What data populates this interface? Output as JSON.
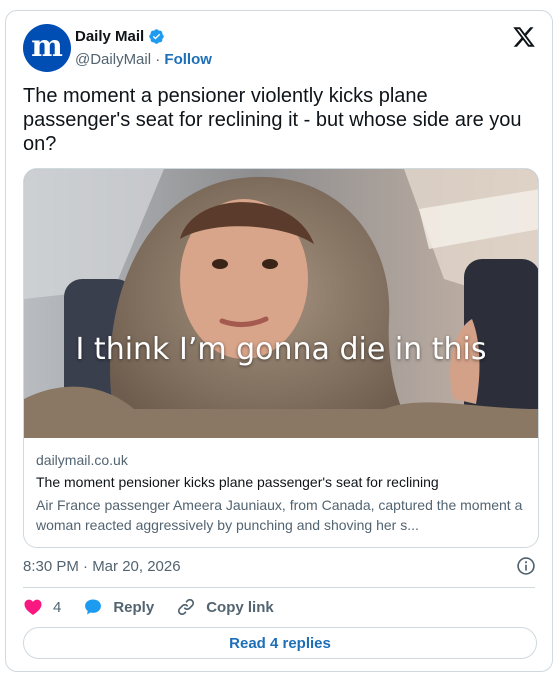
{
  "author": {
    "name": "Daily Mail",
    "handle": "@DailyMail",
    "separator": "·",
    "follow_label": "Follow",
    "avatar_letter": "m",
    "avatar_color": "#004db3",
    "verified_color": "#1d9bf0"
  },
  "tweet": {
    "text": "The moment a pensioner violently kicks plane passenger's seat for reclining it - but whose side are you on?"
  },
  "link_card": {
    "image_caption": "I think I’m gonna die in this",
    "domain": "dailymail.co.uk",
    "title": "The moment pensioner kicks plane passenger's seat for reclining",
    "description": "Air France passenger Ameera Jauniaux, from Canada, captured the moment a woman reacted aggressively by punching and shoving her s..."
  },
  "meta": {
    "time": "8:30 PM · Mar 20, 2026"
  },
  "actions": {
    "like_count": "4",
    "reply_label": "Reply",
    "copy_link_label": "Copy link",
    "read_replies_label": "Read 4 replies",
    "like_color": "#f91880",
    "link_color": "#1d6fb8"
  },
  "icons": {
    "brand": "x-logo-icon",
    "info": "info-icon",
    "like": "heart-icon",
    "reply": "speech-bubble-icon",
    "copy": "link-icon",
    "verified": "verified-badge-icon"
  }
}
